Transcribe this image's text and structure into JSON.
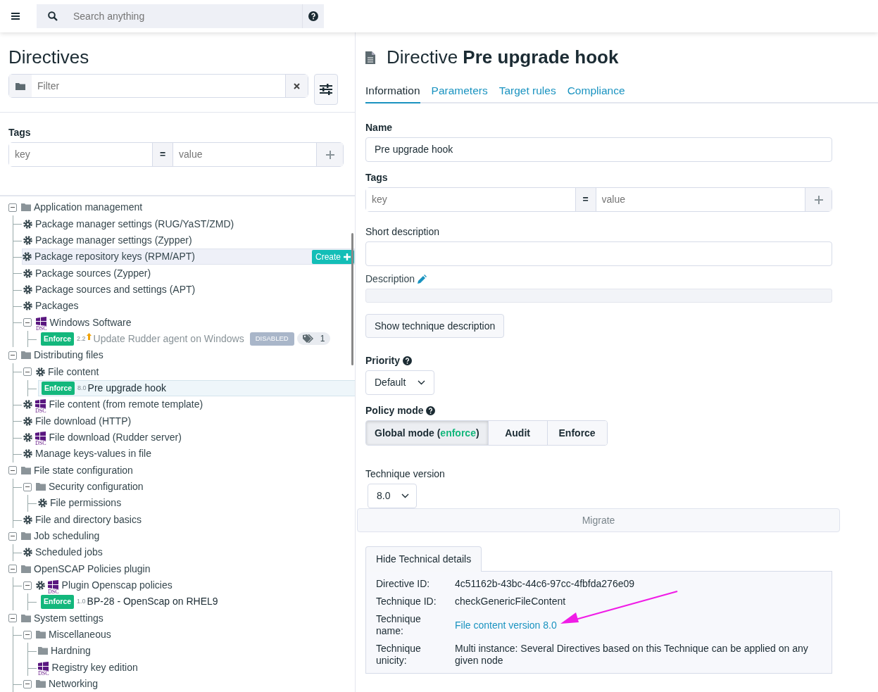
{
  "top_bar": {
    "search": {
      "placeholder": "Search anything"
    }
  },
  "sidebar": {
    "title": "Directives",
    "filter": {
      "placeholder": "Filter"
    },
    "tags": {
      "label": "Tags",
      "key_placeholder": "key",
      "operator": "=",
      "value_placeholder": "value"
    },
    "tree": [
      {
        "kind": "category",
        "label": "Application management",
        "expanded": true,
        "children": [
          {
            "kind": "technique",
            "label": "Package manager settings (RUG/YaST/ZMD)",
            "gear": true
          },
          {
            "kind": "technique",
            "label": "Package manager settings (Zypper)",
            "gear": true
          },
          {
            "kind": "technique",
            "label": "Package repository keys (RPM/APT)",
            "gear": true,
            "action": "Create"
          },
          {
            "kind": "technique",
            "label": "Package sources (Zypper)",
            "gear": true
          },
          {
            "kind": "technique",
            "label": "Package sources and settings (APT)",
            "gear": true
          },
          {
            "kind": "technique",
            "label": "Packages",
            "gear": true
          },
          {
            "kind": "technique",
            "label": "Windows Software",
            "gear": false,
            "platform": "DSC",
            "expanded": true,
            "children": [
              {
                "kind": "directive",
                "mode": "Enforce",
                "version": "2.2",
                "upgrade": true,
                "label": "Update Rudder agent on Windows",
                "disabled": true,
                "status": "DISABLED",
                "tag_count": "1",
                "selected": false
              }
            ]
          }
        ]
      },
      {
        "kind": "category",
        "label": "Distributing files",
        "expanded": true,
        "children": [
          {
            "kind": "technique",
            "label": "File content",
            "gear": true,
            "expanded": true,
            "children": [
              {
                "kind": "directive",
                "mode": "Enforce",
                "version": "8.0",
                "label": "Pre upgrade hook",
                "disabled": false,
                "selected": true
              }
            ]
          },
          {
            "kind": "technique",
            "label": "File content (from remote template)",
            "gear": true,
            "platform": "DSC"
          },
          {
            "kind": "technique",
            "label": "File download (HTTP)",
            "gear": true
          },
          {
            "kind": "technique",
            "label": "File download (Rudder server)",
            "gear": true,
            "platform": "DSC"
          },
          {
            "kind": "technique",
            "label": "Manage keys-values in file",
            "gear": true
          }
        ]
      },
      {
        "kind": "category",
        "label": "File state configuration",
        "expanded": true,
        "children": [
          {
            "kind": "category",
            "label": "Security configuration",
            "expanded": true,
            "children": [
              {
                "kind": "technique",
                "label": "File permissions",
                "gear": true
              }
            ]
          },
          {
            "kind": "technique",
            "label": "File and directory basics",
            "gear": true
          }
        ]
      },
      {
        "kind": "category",
        "label": "Job scheduling",
        "expanded": true,
        "children": [
          {
            "kind": "technique",
            "label": "Scheduled jobs",
            "gear": true
          }
        ]
      },
      {
        "kind": "category",
        "label": "OpenSCAP Policies plugin",
        "expanded": true,
        "children": [
          {
            "kind": "technique",
            "label": "Plugin Openscap policies",
            "gear": true,
            "platform": "DSC",
            "expanded": true,
            "children": [
              {
                "kind": "directive",
                "mode": "Enforce",
                "version": "1.0",
                "label": "BP-28 - OpenScap on RHEL9",
                "disabled": false,
                "selected": false
              }
            ]
          }
        ]
      },
      {
        "kind": "category",
        "label": "System settings",
        "expanded": true,
        "children": [
          {
            "kind": "category",
            "label": "Miscellaneous",
            "expanded": true,
            "children": [
              {
                "kind": "category",
                "label": "Hardning"
              },
              {
                "kind": "technique",
                "label": "Registry key edition",
                "gear": false,
                "platform": "DSC"
              }
            ]
          },
          {
            "kind": "category",
            "label": "Networking",
            "expanded": true
          }
        ]
      }
    ]
  },
  "detail": {
    "title": "Directive **Pre upgrade hook**",
    "tabs": [
      {
        "label": "Information",
        "selected": true
      },
      {
        "label": "Parameters",
        "selected": false
      },
      {
        "label": "Target rules",
        "selected": false
      },
      {
        "label": "Compliance",
        "selected": false
      }
    ],
    "name": {
      "label": "Name",
      "value": "Pre upgrade hook"
    },
    "tags": {
      "label": "Tags",
      "key_placeholder": "key",
      "operator": "=",
      "value_placeholder": "value"
    },
    "short_description": {
      "label": "Short description"
    },
    "description": {
      "label": "Description"
    },
    "show_technique_button": "Show technique description",
    "priority": {
      "label": "Priority",
      "value": "Default"
    },
    "policy_mode": {
      "label": "Policy mode",
      "options": [
        {
          "before": "Global mode (",
          "highlight": "enforce",
          "after": ")",
          "selected": true
        },
        {
          "before": "Audit",
          "selected": false
        },
        {
          "before": "Enforce",
          "selected": false
        }
      ]
    },
    "technique_version": {
      "label": "Technique version",
      "value": "8.0"
    },
    "migrate_button": "Migrate",
    "technical_toggle": "Hide Technical details",
    "technical_details": [
      {
        "label": "Directive ID:",
        "value": "4c51162b-43bc-44c6-97cc-4fbfda276e09",
        "kind": "text"
      },
      {
        "label": "Technique ID:",
        "value": "checkGenericFileContent",
        "kind": "text"
      },
      {
        "label": "Technique name:",
        "value": "File content version 8.0",
        "kind": "link"
      },
      {
        "label": "Technique unicity:",
        "value": "Multi instance: Several Directives based on this Technique can be applied on any given node",
        "kind": "text"
      }
    ]
  }
}
